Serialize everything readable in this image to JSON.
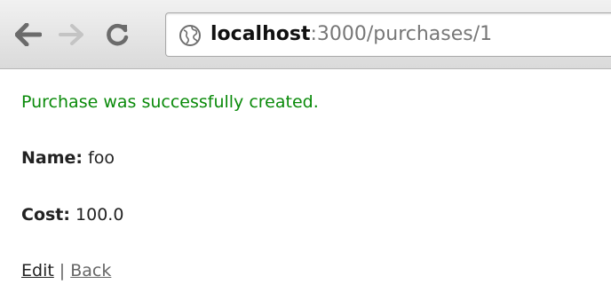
{
  "browser": {
    "url_host": "localhost",
    "url_rest": ":3000/purchases/1",
    "icons": {
      "back": "arrow-left-icon",
      "forward": "arrow-right-icon",
      "reload": "reload-icon",
      "site": "globe-icon"
    }
  },
  "page": {
    "notice": "Purchase was successfully created.",
    "name_label": "Name:",
    "name_value": "foo",
    "cost_label": "Cost:",
    "cost_value": "100.0",
    "edit_link": "Edit",
    "separator": "|",
    "back_link": "Back"
  },
  "colors": {
    "notice": "#0a8a0a",
    "toolbar_top": "#f1f1f1",
    "toolbar_bottom": "#dadada"
  }
}
